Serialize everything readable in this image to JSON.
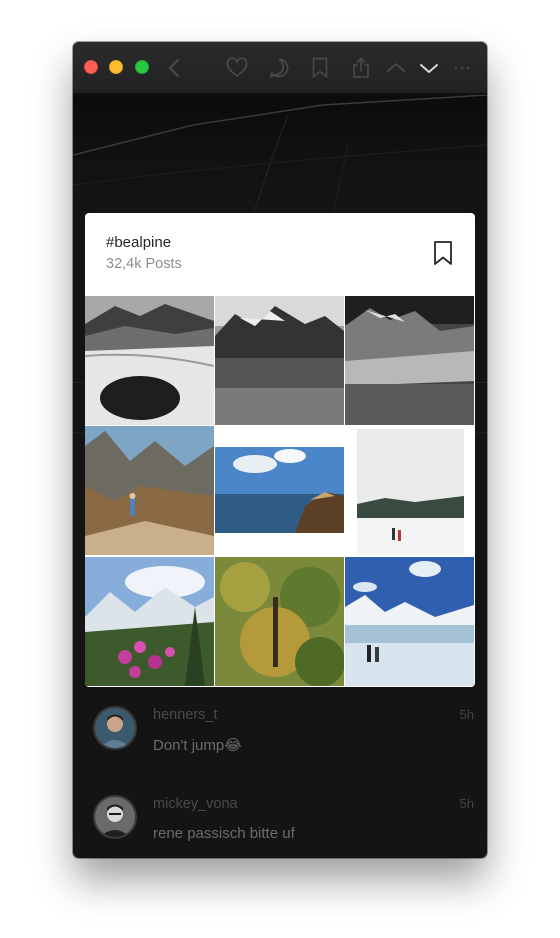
{
  "window": {
    "traffic_lights": [
      "close",
      "minimize",
      "zoom"
    ],
    "toolbar_icons": [
      "back-icon",
      "heart-icon",
      "comment-icon",
      "bookmark-icon",
      "share-icon",
      "chevron-up-icon",
      "chevron-down-icon",
      "more-icon"
    ]
  },
  "hashtag_card": {
    "title": "#bealpine",
    "post_count": "32,4k Posts",
    "save_icon": "bookmark-icon",
    "photos": [
      "snowy-lake-bw",
      "mountain-lake-bw",
      "glacier-valley-bw",
      "hiker-on-ridge",
      "coast-cliff",
      "foggy-snowfield-hikers",
      "pink-flowers-alps",
      "autumn-tree",
      "frozen-lake-hikers"
    ]
  },
  "comments": [
    {
      "username": "henners_t",
      "time": "5h",
      "text": "Don't jump😂"
    },
    {
      "username": "mickey_vona",
      "time": "5h",
      "text": "rene passisch bitte uf"
    }
  ],
  "colors": {
    "window_bg": "#141414",
    "card_bg": "#ffffff",
    "close": "#fc5f57",
    "minimize": "#fdbc2e",
    "zoom": "#28c840"
  }
}
